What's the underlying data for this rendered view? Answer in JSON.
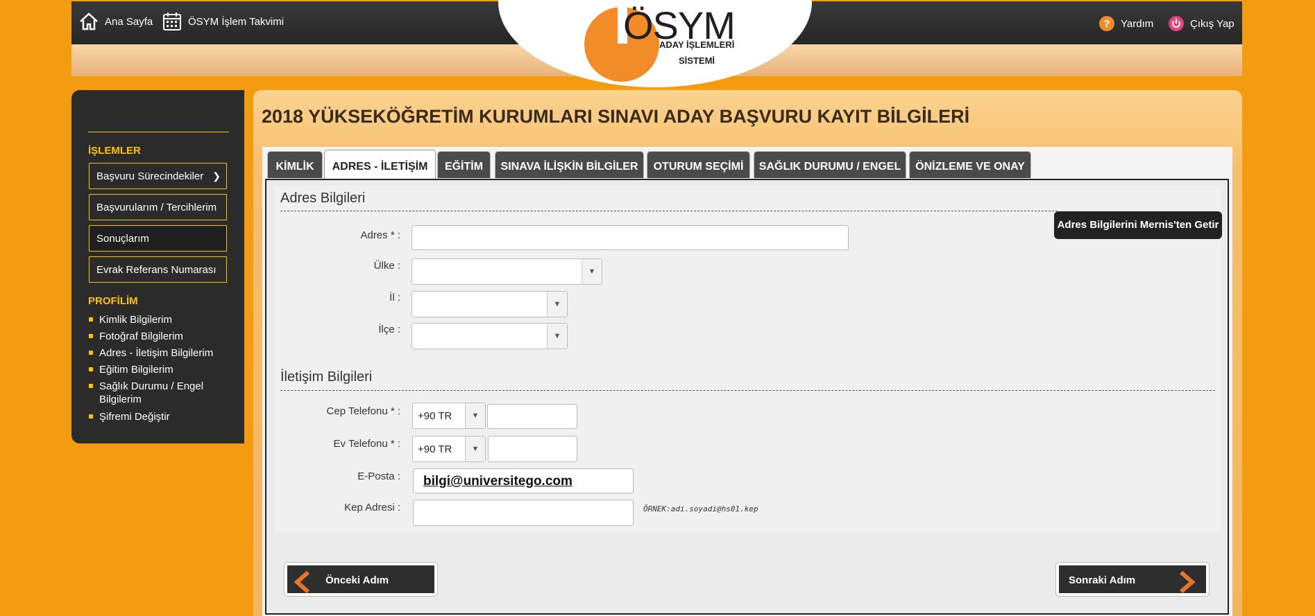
{
  "topnav": {
    "home_label": "Ana Sayfa",
    "calendar_label": "ÖSYM İşlem Takvimi",
    "help_label": "Yardım",
    "logout_label": "Çıkış Yap"
  },
  "logo": {
    "title": "ÖSYM",
    "line1": "ADAY İŞLEMLERİ",
    "line2": "SİSTEMİ"
  },
  "sidebar": {
    "operations_heading": "İŞLEMLER",
    "operations": [
      {
        "label": "Başvuru Sürecindekiler"
      },
      {
        "label": "Başvurularım / Tercihlerim"
      },
      {
        "label": "Sonuçlarım"
      },
      {
        "label": "Evrak Referans Numarası"
      }
    ],
    "profile_heading": "PROFİLİM",
    "profile_items": [
      {
        "label": "Kimlik Bilgilerim"
      },
      {
        "label": "Fotoğraf Bilgilerim"
      },
      {
        "label": "Adres - İletişim Bilgilerim"
      },
      {
        "label": "Eğitim Bilgilerim"
      },
      {
        "label": "Sağlık Durumu / Engel Bilgilerim"
      },
      {
        "label": "Şifremi Değiştir"
      }
    ]
  },
  "page_title": "2018 YÜKSEKÖĞRETİM KURUMLARI SINAVI ADAY BAŞVURU KAYIT BİLGİLERİ",
  "tabs": [
    {
      "label": "KİMLİK"
    },
    {
      "label": "ADRES - İLETİŞİM"
    },
    {
      "label": "EĞİTİM"
    },
    {
      "label": "SINAVA İLİŞKİN BİLGİLER"
    },
    {
      "label": "OTURUM SEÇİMİ"
    },
    {
      "label": "SAĞLIK DURUMU / ENGEL"
    },
    {
      "label": "ÖNİZLEME VE ONAY"
    }
  ],
  "address": {
    "section_title": "Adres Bilgileri",
    "mernis_button": "Adres Bilgilerini Mernis'ten Getir",
    "address_label": "Adres * :",
    "address_value": "",
    "country_label": "Ülke :",
    "country_value": "",
    "province_label": "İl :",
    "province_value": "",
    "district_label": "İlçe :",
    "district_value": ""
  },
  "contact": {
    "section_title": "İletişim Bilgileri",
    "mobile_label": "Cep Telefonu * :",
    "mobile_code": "+90 TR",
    "mobile_value": "",
    "home_label": "Ev Telefonu * :",
    "home_code": "+90 TR",
    "home_value": "",
    "email_label": "E-Posta :",
    "email_value": "bilgi@universitego.com",
    "kep_label": "Kep Adresi :",
    "kep_value": "",
    "kep_hint": "ÖRNEK:adi.soyadi@hs01.kep"
  },
  "steps": {
    "prev_label": "Önceki Adım",
    "next_label": "Sonraki Adım"
  },
  "colors": {
    "page_background": "#f39c12",
    "sidebar_accent": "#ffc20e",
    "logo_orange": "#f28c28"
  }
}
